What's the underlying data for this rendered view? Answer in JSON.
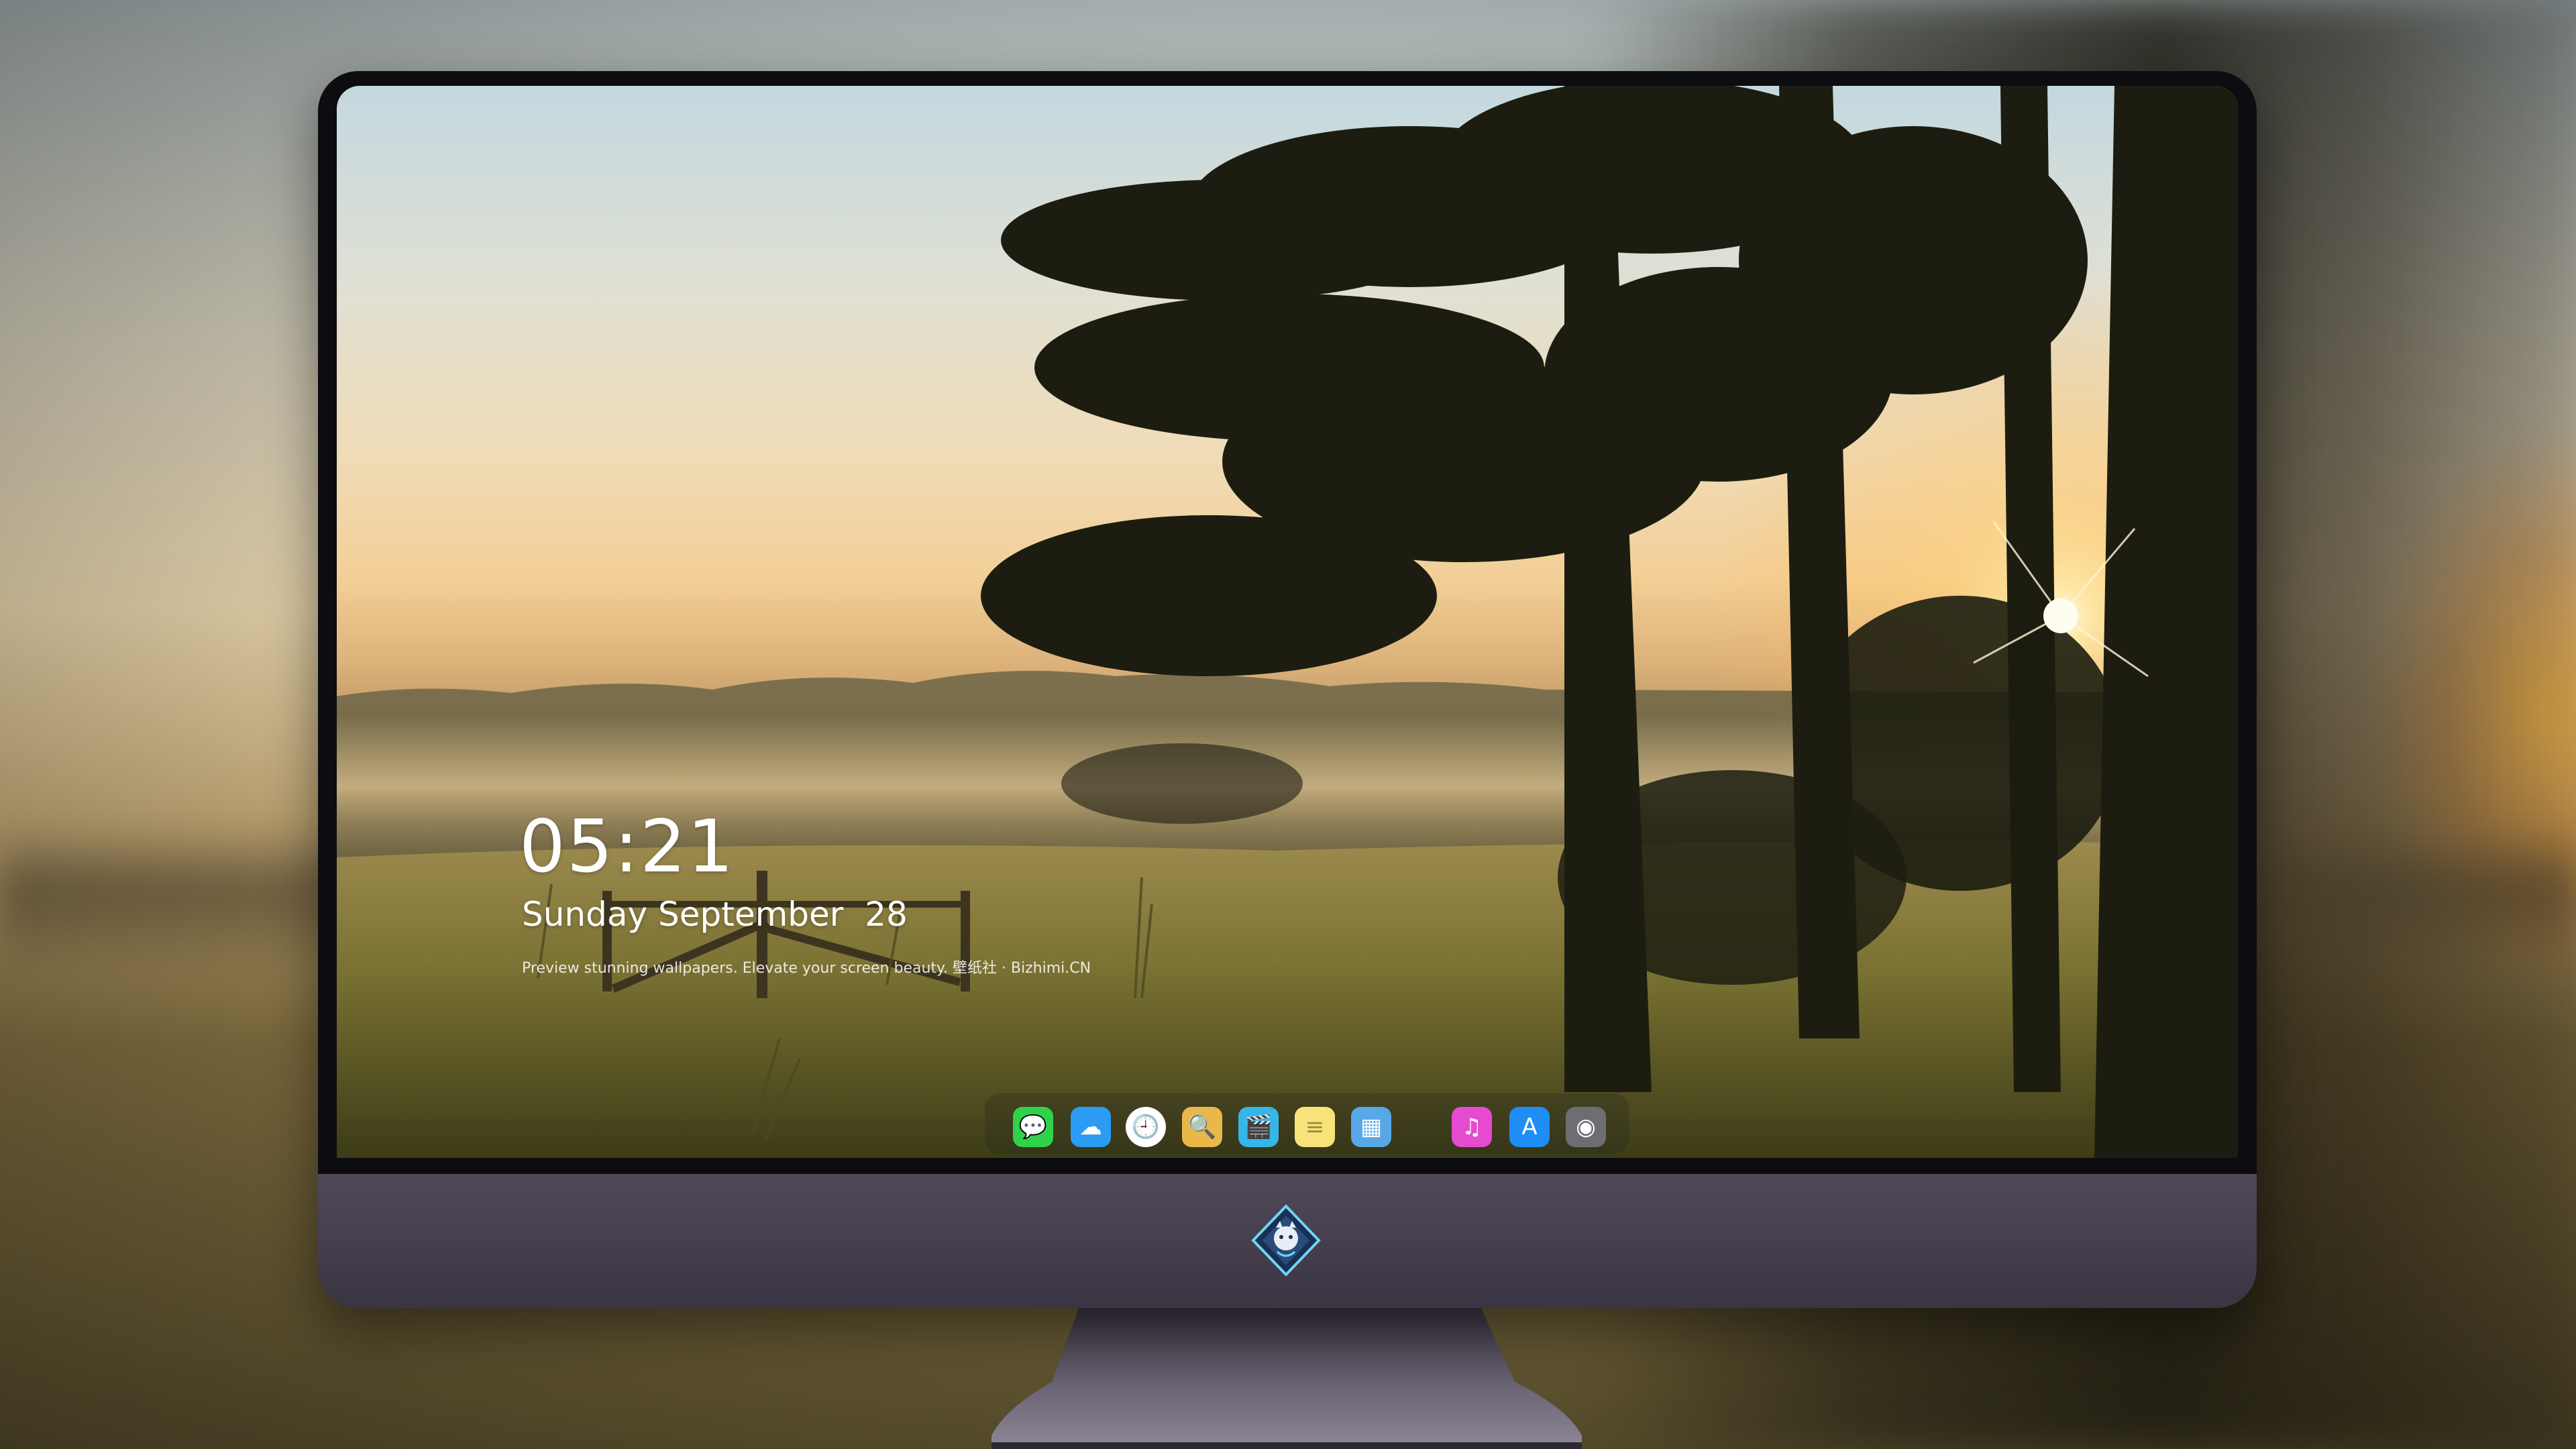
{
  "lock_screen": {
    "time": "05:21",
    "date": "Sunday September  28",
    "tagline": "Preview stunning wallpapers. Elevate your screen beauty. 壁纸社 · Bizhimi.CN"
  },
  "dock": {
    "apps": [
      {
        "icon": "messages-icon",
        "glyph": "💬",
        "color": "#2fd24a"
      },
      {
        "icon": "weather-icon",
        "glyph": "☁",
        "color": "#2b9bf4"
      },
      {
        "icon": "clock-icon",
        "glyph": "🕘",
        "color": "#ffffff"
      },
      {
        "icon": "preview-icon",
        "glyph": "🔍",
        "color": "#e9b84a"
      },
      {
        "icon": "clips-icon",
        "glyph": "🎬",
        "color": "#36b6e8"
      },
      {
        "icon": "notes-icon",
        "glyph": "≡",
        "color": "#f7e37a"
      },
      {
        "icon": "photos-app-icon",
        "glyph": "▦",
        "color": "#58a8e8"
      },
      {
        "icon": "music-icon",
        "glyph": "♫",
        "color": "#e54bd0"
      },
      {
        "icon": "app-store-icon",
        "glyph": "A",
        "color": "#1e8df5"
      },
      {
        "icon": "camera-icon",
        "glyph": "◉",
        "color": "#6d6d72"
      }
    ]
  }
}
